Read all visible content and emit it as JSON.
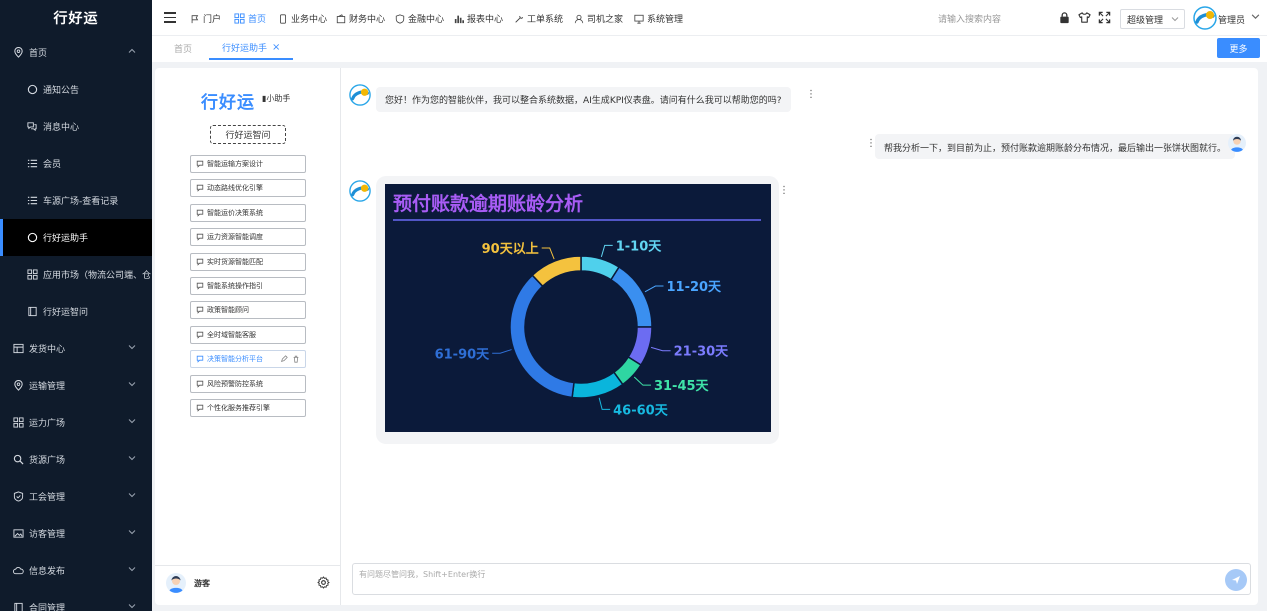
{
  "sidebar": {
    "brand": "行好运",
    "items": [
      {
        "label": "首页",
        "level": "top",
        "icon": "location-pin-icon",
        "expanded": true
      },
      {
        "label": "通知公告",
        "level": "sub",
        "icon": "circle-icon"
      },
      {
        "label": "消息中心",
        "level": "sub",
        "icon": "chat-bubbles-icon"
      },
      {
        "label": "会员",
        "level": "sub",
        "icon": "list-icon"
      },
      {
        "label": "车源广场-查看记录",
        "level": "sub",
        "icon": "list-icon"
      },
      {
        "label": "行好运助手",
        "level": "sub",
        "icon": "circle-icon",
        "active": true
      },
      {
        "label": "应用市场（物流公司端、仓",
        "level": "sub",
        "icon": "grid-icon"
      },
      {
        "label": "行好运智问",
        "level": "sub",
        "icon": "book-icon"
      },
      {
        "label": "发货中心",
        "level": "top",
        "icon": "table-icon"
      },
      {
        "label": "运输管理",
        "level": "top",
        "icon": "location-pin-icon"
      },
      {
        "label": "运力广场",
        "level": "top",
        "icon": "grid-icon"
      },
      {
        "label": "货源广场",
        "level": "top",
        "icon": "search-icon"
      },
      {
        "label": "工会管理",
        "level": "top",
        "icon": "shield-check-icon"
      },
      {
        "label": "访客管理",
        "level": "top",
        "icon": "image-icon"
      },
      {
        "label": "信息发布",
        "level": "top",
        "icon": "cloud-icon"
      },
      {
        "label": "合同管理",
        "level": "top",
        "icon": "book-icon"
      }
    ]
  },
  "topnav": {
    "items": [
      {
        "label": "门户",
        "icon": "flag-icon"
      },
      {
        "label": "首页",
        "icon": "grid-icon",
        "active": true
      },
      {
        "label": "业务中心",
        "icon": "phone-icon"
      },
      {
        "label": "财务中心",
        "icon": "wallet-icon"
      },
      {
        "label": "金融中心",
        "icon": "shield-icon"
      },
      {
        "label": "报表中心",
        "icon": "bar-chart-icon"
      },
      {
        "label": "工单系统",
        "icon": "tools-icon"
      },
      {
        "label": "司机之家",
        "icon": "person-icon"
      },
      {
        "label": "系统管理",
        "icon": "monitor-icon"
      }
    ],
    "search_placeholder": "请输入搜索内容",
    "role": "超级管理",
    "user": "管理员"
  },
  "tabs": {
    "items": [
      {
        "label": "首页",
        "active": false
      },
      {
        "label": "行好运助手",
        "active": true,
        "closable": true
      }
    ],
    "more_label": "更多"
  },
  "left_panel": {
    "logo": "行好运",
    "assistant_label": "小助手",
    "ask_button": "行好运智问",
    "questions": [
      "智能运输方案设计",
      "动态路线优化引擎",
      "智能运价决策系统",
      "运力资源智能调度",
      "实时货源智能匹配",
      "智能系统操作指引",
      "政策智能顾问",
      "全时域智能客服",
      "决策智能分析平台",
      "风险预警防控系统",
      "个性化服务推荐引擎"
    ],
    "hover_index": 8,
    "guest_label": "游客"
  },
  "chat": {
    "bot_greeting": "您好！作为您的智能伙伴，我可以整合系统数据，AI生成KPI仪表盘。请问有什么我可以帮助您的吗?",
    "user_message": "帮我分析一下，到目前为止，预付账款逾期账龄分布情况，最后输出一张饼状图就行。",
    "input_placeholder": "有问题尽管问我，Shift+Enter换行"
  },
  "chart_data": {
    "type": "pie",
    "title": "预付账款逾期账龄分析",
    "donut": true,
    "categories": [
      "1-10天",
      "11-20天",
      "21-30天",
      "31-45天",
      "46-60天",
      "61-90天",
      "90天以上"
    ],
    "values": [
      9,
      16,
      9,
      6,
      12,
      36,
      12
    ],
    "colors": [
      "#4fd0ec",
      "#3a8ff0",
      "#6c6cf2",
      "#2fd6a2",
      "#0ab5dc",
      "#2f7ae6",
      "#f4c23e"
    ],
    "label_colors": [
      "#62d6f3",
      "#4aa5ff",
      "#7c7cff",
      "#3fe3a8",
      "#17b9e0",
      "#2f6fd6",
      "#f4c23e"
    ],
    "legend": "none",
    "background": "#0b1a3a",
    "title_color": "#a85cf5"
  }
}
